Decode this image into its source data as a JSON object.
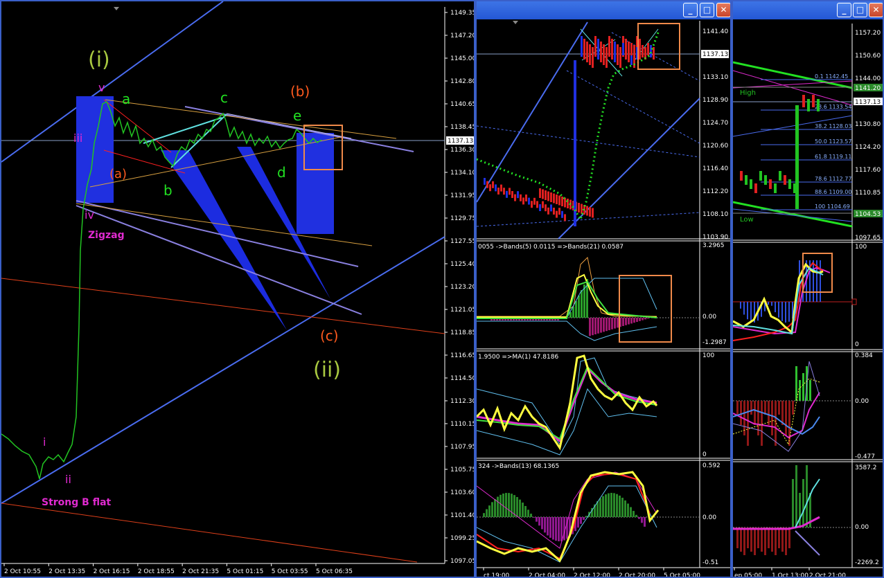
{
  "windows": {
    "main": {
      "y_ticks": [
        "1149.35",
        "1147.20",
        "1145.00",
        "1142.80",
        "1140.65",
        "1138.45",
        "1136.30",
        "1134.10",
        "1131.95",
        "1129.75",
        "1127.55",
        "1125.40",
        "1123.20",
        "1121.05",
        "1118.85",
        "1116.65",
        "1114.50",
        "1112.30",
        "1110.15",
        "1107.95",
        "1105.75",
        "1103.60",
        "1101.40",
        "1099.25",
        "1097.05"
      ],
      "x_ticks": [
        "2 Oct 10:55",
        "2 Oct 13:35",
        "2 Oct 16:15",
        "2 Oct 18:55",
        "2 Oct 21:35",
        "5 Oct 01:15",
        "5 Oct 03:55",
        "5 Oct 06:35"
      ],
      "price_tag": "1137.13",
      "wave_labels": {
        "i_major": "(i)",
        "ii_major": "(ii)",
        "v": "v",
        "iii": "iii",
        "iv": "iv",
        "i": "i",
        "ii": "ii",
        "a": "a",
        "b": "b",
        "c": "c",
        "d": "d",
        "e": "e",
        "a_paren": "(a)",
        "b_paren": "(b)",
        "c_paren": "(c)",
        "zigzag": "Zigzag",
        "strong_b_flat": "Strong B flat"
      }
    },
    "middle": {
      "title_buttons": [
        "_",
        "□",
        "✕"
      ],
      "main_ticks": [
        "1141.40",
        "1137.13",
        "1133.10",
        "1128.90",
        "1124.70",
        "1120.60",
        "1116.40",
        "1112.20",
        "1108.10",
        "1103.90"
      ],
      "price_tag": "1137.13",
      "ind1_label": "0055  ->Bands(5) 0.0115  =>Bands(21) 0.0587",
      "ind1_ticks": [
        "3.2965",
        "0.00",
        "-1.2987"
      ],
      "ind2_label": "1.9500  =>MA(1) 47.8186",
      "ind2_ticks": [
        "100",
        "0"
      ],
      "ind3_label": "324  ->Bands(13) 68.1365",
      "ind3_ticks": [
        "0.592",
        "0.00",
        "-0.51"
      ],
      "x_ticks": [
        "ct 19:00",
        "2 Oct 04:00",
        "2 Oct 12:00",
        "2 Oct 20:00",
        "5 Oct 05:00"
      ]
    },
    "right": {
      "title_buttons": [
        "_",
        "□",
        "✕"
      ],
      "main_ticks": [
        "1157.20",
        "1150.60",
        "1144.00",
        "1137.13",
        "1130.80",
        "1124.20",
        "1117.60",
        "1110.85",
        "1104.53",
        "1097.65"
      ],
      "price_tag": "1137.13",
      "high_tag": "1141.20",
      "low_tag": "1104.53",
      "high_label": "High",
      "low_label": "Low",
      "fib_levels": [
        "0.1 1142.45",
        "23.6 1133.54",
        "38.2 1128.03",
        "50.0 1123.57",
        "61.8 1119.11",
        "78.6 1112.77",
        "88.6 1109.00",
        "100 1104.69"
      ],
      "ind1_ticks": [
        "100",
        "0"
      ],
      "ind2_ticks": [
        "0.384",
        "0.00",
        "-0.477"
      ],
      "ind3_ticks": [
        "3587.2",
        "0.00",
        "-2269.2"
      ],
      "x_ticks": [
        "ep 05:00",
        "1 Oct 13:00",
        "2 Oct 21:00"
      ]
    }
  },
  "colors": {
    "candle_green": "#22c422",
    "wave_green": "#7ec93a",
    "wave_magenta": "#e02ad0",
    "wave_orange": "#ff5a1e",
    "channel_blue": "#4a6cf0",
    "box_orange": "#f08a4a"
  }
}
